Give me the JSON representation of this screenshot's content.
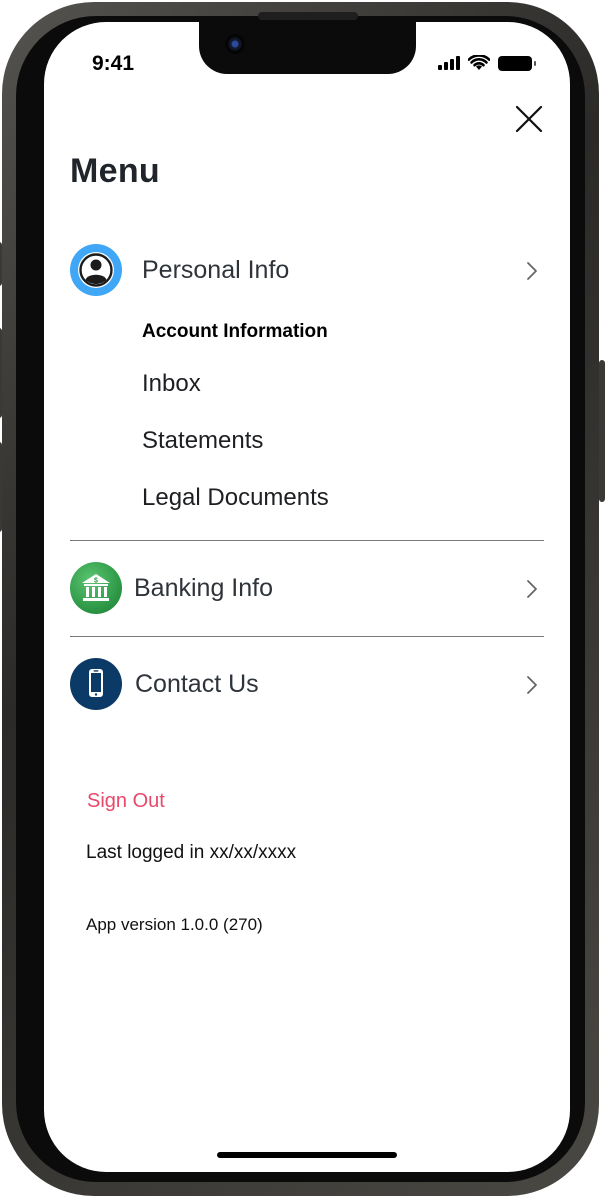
{
  "status_bar": {
    "time": "9:41"
  },
  "menu": {
    "title": "Menu",
    "personal_info": {
      "label": "Personal Info",
      "subheading": "Account Information",
      "items": [
        "Inbox",
        "Statements",
        "Legal Documents"
      ]
    },
    "banking_info": {
      "label": "Banking Info"
    },
    "contact_us": {
      "label": "Contact Us"
    }
  },
  "footer": {
    "sign_out": "Sign Out",
    "last_logged": "Last logged in xx/xx/xxxx",
    "app_version": "App version 1.0.0 (270)"
  },
  "colors": {
    "sign_out": "#e8486a",
    "personal_icon_bg": "#3fa7f5",
    "banking_icon_bg": "#2f9a48",
    "contact_icon_bg": "#0c3a66"
  },
  "icons": {
    "close": "close-icon",
    "personal": "user-icon",
    "banking": "bank-icon",
    "contact": "phone-icon",
    "chevron": "chevron-right-icon"
  }
}
